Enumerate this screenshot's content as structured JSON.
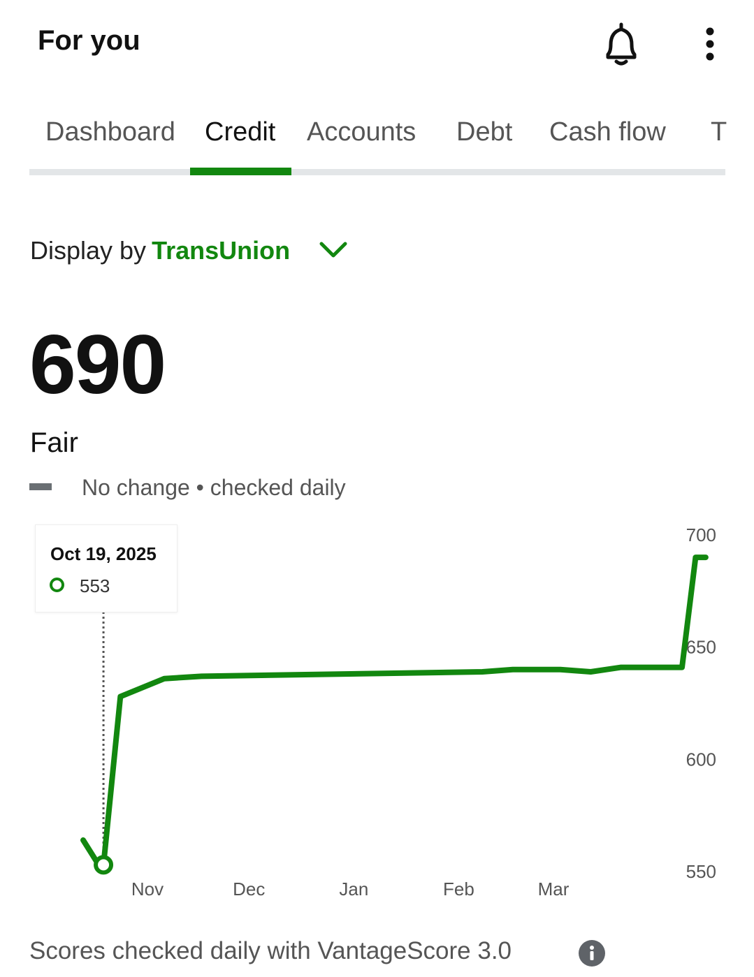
{
  "header": {
    "title": "For you",
    "icons": [
      "bell-icon",
      "more-vertical-icon"
    ]
  },
  "tabs": [
    {
      "label": "Dashboard",
      "active": false
    },
    {
      "label": "Credit",
      "active": true
    },
    {
      "label": "Accounts",
      "active": false
    },
    {
      "label": "Debt",
      "active": false
    },
    {
      "label": "Cash flow",
      "active": false
    },
    {
      "label": "T",
      "active": false
    }
  ],
  "display": {
    "prefix": "Display by",
    "bureau": "TransUnion"
  },
  "score": {
    "value": "690",
    "rating": "Fair",
    "change_text": "No change • checked daily"
  },
  "tooltip": {
    "date": "Oct 19, 2025",
    "value": "553"
  },
  "footer": {
    "text": "Scores checked daily with VantageScore 3.0"
  },
  "colors": {
    "accent": "#12870f",
    "tab_track": "#e3e6e8",
    "muted_text": "#555555"
  },
  "chart_data": {
    "type": "line",
    "y_ticks": [
      "700",
      "650",
      "600",
      "550"
    ],
    "ylim": [
      550,
      700
    ],
    "x_ticks": [
      "Nov",
      "Dec",
      "Jan",
      "Feb",
      "Mar"
    ],
    "series": [
      {
        "values": [
          {
            "x": "2025-10-13",
            "y": 564
          },
          {
            "x": "2025-10-18",
            "y": 552
          },
          {
            "x": "2025-10-19",
            "y": 553
          },
          {
            "x": "2025-10-24",
            "y": 628
          },
          {
            "x": "2025-11-06",
            "y": 636
          },
          {
            "x": "2025-11-17",
            "y": 637
          },
          {
            "x": "2026-02-08",
            "y": 639
          },
          {
            "x": "2026-02-17",
            "y": 640
          },
          {
            "x": "2026-03-03",
            "y": 640
          },
          {
            "x": "2026-03-12",
            "y": 639
          },
          {
            "x": "2026-03-21",
            "y": 641
          },
          {
            "x": "2026-04-08",
            "y": 641
          },
          {
            "x": "2026-04-12",
            "y": 690
          },
          {
            "x": "2026-04-15",
            "y": 690
          }
        ]
      }
    ],
    "highlight": {
      "x": "2025-10-19",
      "y": 553
    }
  }
}
